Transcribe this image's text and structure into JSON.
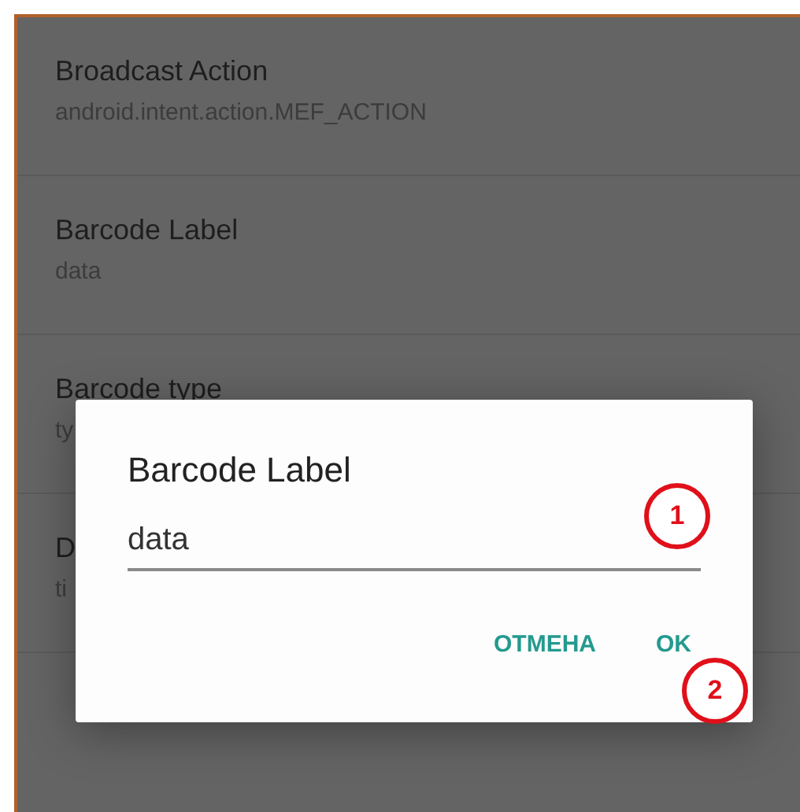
{
  "settings_rows": [
    {
      "title": "Broadcast Action",
      "summary": "android.intent.action.MEF_ACTION"
    },
    {
      "title": "Barcode Label",
      "summary": "data"
    },
    {
      "title": "Barcode type",
      "summary": "ty"
    },
    {
      "title": "D",
      "summary": "ti"
    }
  ],
  "dialog": {
    "title": "Barcode Label",
    "value": "data",
    "buttons": [
      "ОТМЕНА",
      "OK"
    ]
  },
  "markers": [
    "1",
    "2"
  ]
}
